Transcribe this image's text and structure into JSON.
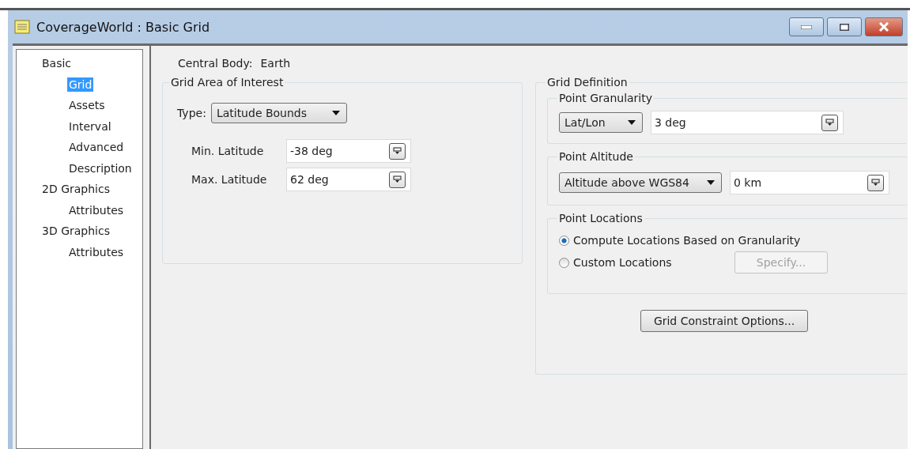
{
  "window": {
    "title": "CoverageWorld : Basic Grid"
  },
  "tree": [
    {
      "label": "Basic",
      "selected": false,
      "children": [
        {
          "label": "Grid",
          "selected": true
        },
        {
          "label": "Assets",
          "selected": false
        },
        {
          "label": "Interval",
          "selected": false
        },
        {
          "label": "Advanced",
          "selected": false
        },
        {
          "label": "Description",
          "selected": false
        }
      ]
    },
    {
      "label": "2D Graphics",
      "selected": false,
      "children": [
        {
          "label": "Attributes",
          "selected": false
        }
      ]
    },
    {
      "label": "3D Graphics",
      "selected": false,
      "children": [
        {
          "label": "Attributes",
          "selected": false
        }
      ]
    }
  ],
  "central_body": {
    "label": "Central Body:",
    "value": "Earth"
  },
  "area_of_interest": {
    "title": "Grid Area of Interest",
    "type_label": "Type:",
    "type_value": "Latitude Bounds",
    "fields": [
      {
        "label": "Min. Latitude",
        "value": "-38 deg"
      },
      {
        "label": "Max. Latitude",
        "value": "62 deg"
      }
    ]
  },
  "grid_definition": {
    "title": "Grid Definition",
    "granularity": {
      "title": "Point Granularity",
      "method": "Lat/Lon",
      "value": "3 deg"
    },
    "altitude": {
      "title": "Point Altitude",
      "reference": "Altitude above WGS84",
      "value": "0 km"
    },
    "locations": {
      "title": "Point Locations",
      "options": [
        {
          "label": "Compute Locations Based on Granularity",
          "selected": true
        },
        {
          "label": "Custom Locations",
          "selected": false
        }
      ],
      "specify_button": {
        "label": "Specify...",
        "disabled": true
      }
    },
    "constraint_button": "Grid Constraint Options..."
  }
}
